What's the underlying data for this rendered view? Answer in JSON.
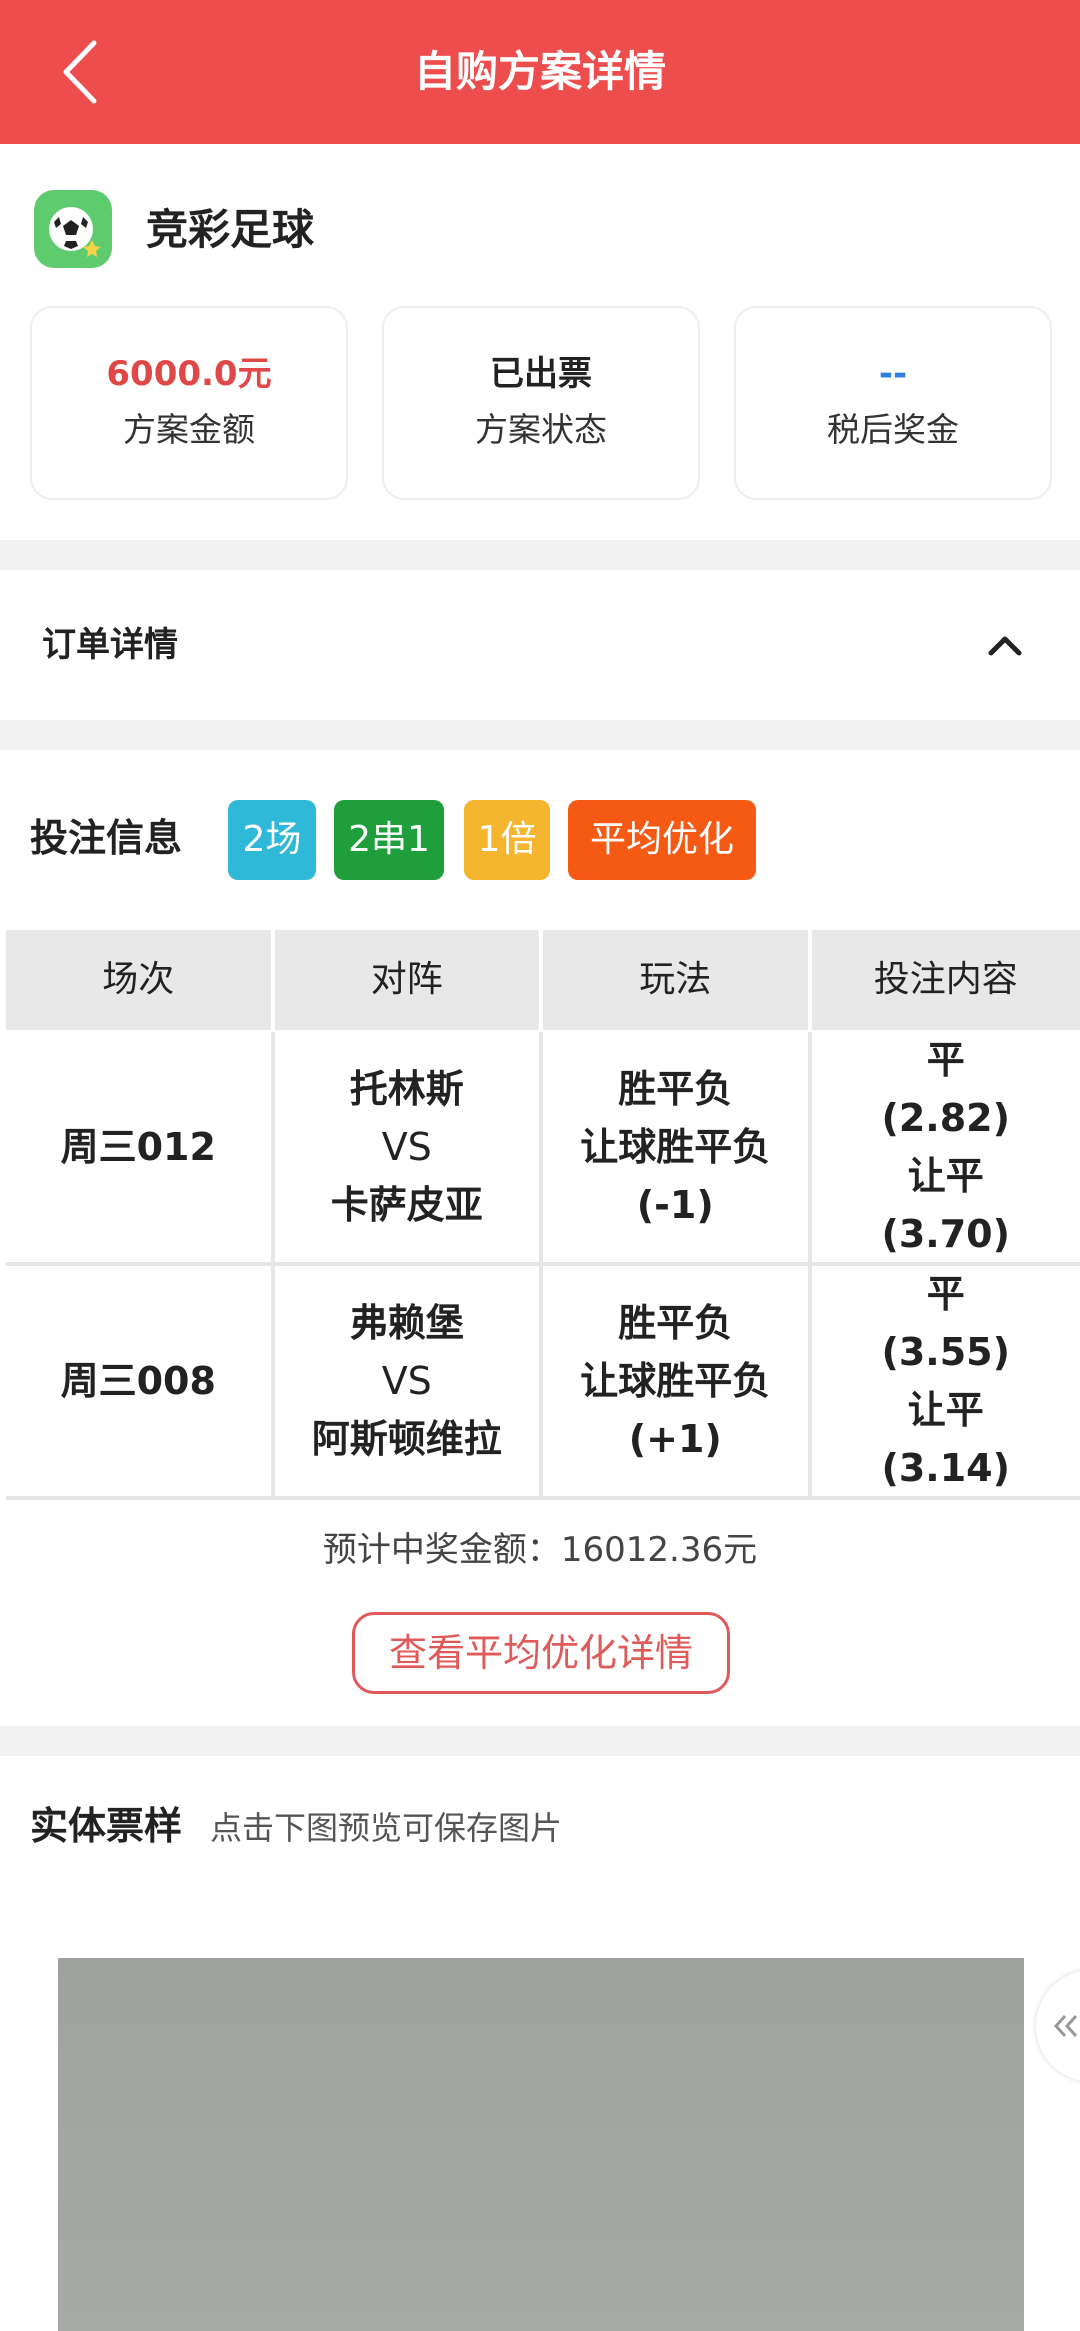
{
  "header": {
    "title": "自购方案详情"
  },
  "lottery": {
    "name": "竞彩足球"
  },
  "stats": [
    {
      "value": "6000.0元",
      "label": "方案金额",
      "color": "#e04848"
    },
    {
      "value": "已出票",
      "label": "方案状态",
      "color": "#222222"
    },
    {
      "value": "--",
      "label": "税后奖金",
      "color": "#2f7fe0"
    }
  ],
  "order": {
    "title": "订单详情"
  },
  "bet": {
    "title": "投注信息",
    "tags": [
      {
        "label": "2场",
        "color": "#2fb8d8"
      },
      {
        "label": "2串1",
        "color": "#1f9e3c"
      },
      {
        "label": "1倍",
        "color": "#f5b52e"
      },
      {
        "label": "平均优化",
        "color": "#f55a14"
      }
    ],
    "columns": [
      "场次",
      "对阵",
      "玩法",
      "投注内容"
    ],
    "rows": [
      {
        "match_no": "周三012",
        "home": "托林斯",
        "vs": "VS",
        "away": "卡萨皮亚",
        "play1": "胜平负",
        "play2": "让球胜平负",
        "handicap": "(-1)",
        "pick1": "平",
        "odds1": "(2.82)",
        "pick2": "让平",
        "odds2": "(3.70)"
      },
      {
        "match_no": "周三008",
        "home": "弗赖堡",
        "vs": "VS",
        "away": "阿斯顿维拉",
        "play1": "胜平负",
        "play2": "让球胜平负",
        "handicap": "(+1)",
        "pick1": "平",
        "odds1": "(3.55)",
        "pick2": "让平",
        "odds2": "(3.14)"
      }
    ],
    "expected_prize": "预计中奖金额：16012.36元",
    "detail_button": "查看平均优化详情"
  },
  "ticket": {
    "title": "实体票样",
    "hint": "点击下图预览可保存图片"
  },
  "icons": [
    "back-arrow-icon",
    "football-icon",
    "chevron-up-icon",
    "double-chevron-left-icon"
  ]
}
